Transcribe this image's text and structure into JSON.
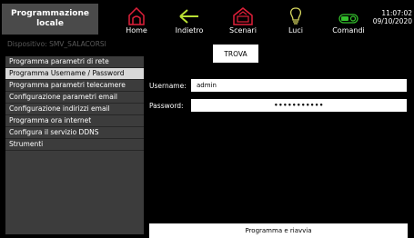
{
  "header": {
    "title_line1": "Programmazione",
    "title_line2": "locale",
    "nav": [
      {
        "label": "Home",
        "icon": "home-icon",
        "color": "#e0203a"
      },
      {
        "label": "Indietro",
        "icon": "back-arrow-icon",
        "color": "#b8e034"
      },
      {
        "label": "Scenari",
        "icon": "scenarios-icon",
        "color": "#e0203a"
      },
      {
        "label": "Luci",
        "icon": "lightbulb-icon",
        "color": "#d8d860"
      },
      {
        "label": "Comandi",
        "icon": "on-switch-icon",
        "color": "#34c22c"
      }
    ],
    "time": "11:07:02",
    "date": "09/10/2020"
  },
  "device": "Dispositivo: SMV_SALACORSI",
  "sidebar": {
    "items": [
      {
        "label": "Programma parametri di rete"
      },
      {
        "label": "Programma Username / Password"
      },
      {
        "label": "Programma parametri telecamere"
      },
      {
        "label": "Configurazione parametri email"
      },
      {
        "label": "Configurazione indirizzi email"
      },
      {
        "label": "Programma ora internet"
      },
      {
        "label": "Configura il servizio DDNS"
      },
      {
        "label": "Strumenti"
      }
    ],
    "selected_index": 1
  },
  "main": {
    "search_label": "TROVA",
    "username_label": "Username:",
    "username_value": "admin",
    "password_label": "Password:",
    "password_value": "•••••••••••",
    "program_button_label": "Programma e riavvia"
  }
}
